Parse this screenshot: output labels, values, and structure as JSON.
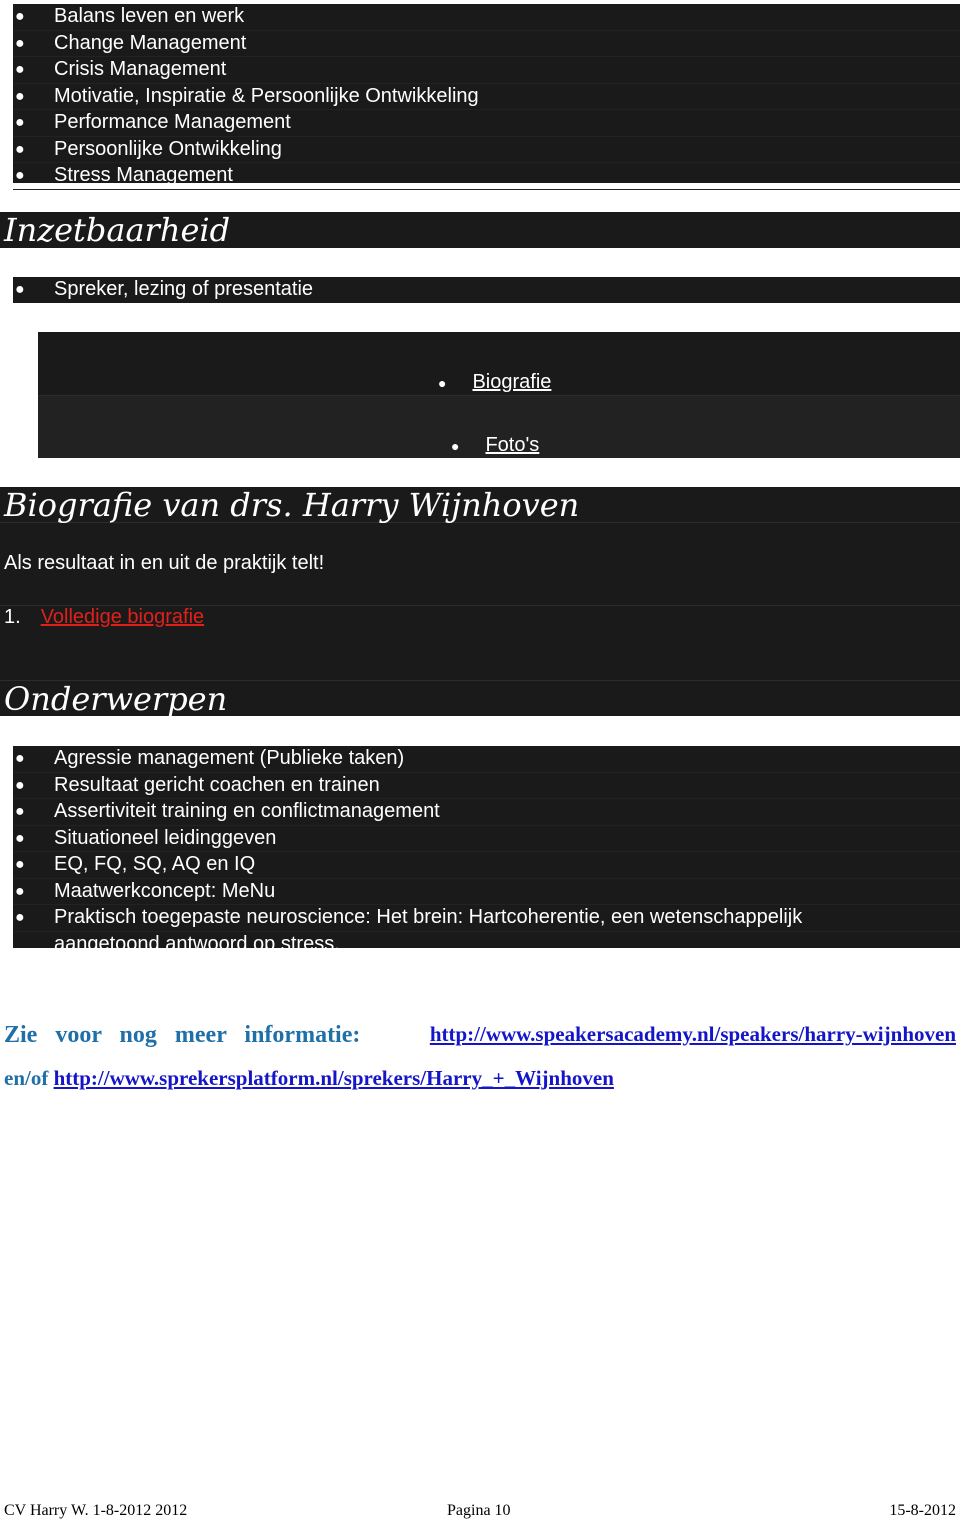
{
  "top_list": [
    "Balans leven en werk",
    "Change Management",
    "Crisis Management",
    "Motivatie, Inspiratie & Persoonlijke Ontwikkeling",
    "Performance Management",
    "Persoonlijke Ontwikkeling",
    "Stress Management"
  ],
  "inzet": {
    "title": "Inzetbaarheid",
    "items": [
      "Spreker, lezing of presentatie"
    ]
  },
  "nav": {
    "biografie": "Biografie",
    "fotos": "Foto's"
  },
  "bio": {
    "title": "Biografie van drs. Harry Wijnhoven",
    "tagline": "Als resultaat in en uit de praktijk telt!",
    "num": "1.",
    "link": "Volledige biografie",
    "link_color": "#e0201b"
  },
  "onderwerpen": {
    "title": "Onderwerpen",
    "items": [
      "Agressie management (Publieke taken)",
      "Resultaat gericht coachen en trainen",
      "Assertiviteit training en conflictmanagement",
      "Situationeel leidinggeven",
      "EQ, FQ, SQ, AQ en IQ",
      "Maatwerkconcept: MeNu",
      "Praktisch toegepaste neuroscience: Het brein: Hartcoherentie, een wetenschappelijk",
      "aangetoond antwoord op stress."
    ]
  },
  "more": {
    "label": "Zie voor nog meer informatie:",
    "link1": "http://www.speakersacademy.nl/speakers/harry-wijnhoven",
    "prefix2": "en/of",
    "link2": "http://www.sprekersplatform.nl/sprekers/Harry_+_Wijnhoven",
    "label_color": "#1f6fa8"
  },
  "footer": {
    "left": "CV Harry W. 1-8-2012 2012",
    "center": "Pagina 10",
    "right": "15-8-2012"
  }
}
